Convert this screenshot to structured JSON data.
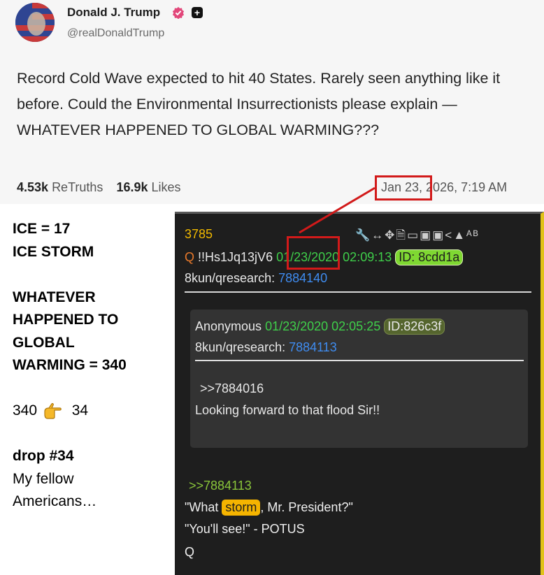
{
  "post": {
    "author_name": "Donald J. Trump",
    "handle": "@realDonaldTrump",
    "text": "Record Cold Wave expected to hit 40 States. Rarely seen anything like it before. Could the Environmental Insurrectionists please explain — WHATEVER HAPPENED TO GLOBAL WARMING???",
    "retruths_count": "4.53k",
    "retruths_label": "ReTruths",
    "likes_count": "16.9k",
    "likes_label": "Likes",
    "date_highlight": "Jan 23",
    "date_rest": ", 2026, 7:19 AM"
  },
  "notes": {
    "line1": "ICE = 17",
    "line2": "ICE STORM",
    "line3": "WHATEVER",
    "line4": "HAPPENED TO",
    "line5": "GLOBAL",
    "line6": "WARMING = 340",
    "from_number": "340",
    "to_number": "34",
    "drop": "drop #34",
    "quote_line1": "My fellow",
    "quote_line2": "Americans…"
  },
  "qpost": {
    "number": "3785",
    "tools": "🔧↔✥🗎▭▣▣<▲ᴬᴮ",
    "author_q": "Q",
    "tripcode": " !!Hs1Jq13jV6 ",
    "date": "01/23/2020",
    "time": " 02:09:13 ",
    "id": "ID: 8cdd1a",
    "board": "8kun/qresearch: ",
    "post_no": "7884140",
    "reply": {
      "author": "Anonymous ",
      "datetime": "01/23/2020 02:05:25 ",
      "id": "ID:826c3f",
      "board": "8kun/qresearch: ",
      "post_no": "7884113",
      "ref": ">>7884016",
      "message": "Looking forward to that flood Sir!!"
    },
    "ref": ">>7884113",
    "quote_before": "\"What ",
    "quote_storm": "storm",
    "quote_after": ", Mr. President?\"",
    "quote2": "\"You'll see!\" - POTUS",
    "signature": "Q"
  },
  "colors": {
    "highlight_box": "#d21a1a",
    "storm_highlight": "#f5b400",
    "panel_border": "#e0c21a"
  }
}
